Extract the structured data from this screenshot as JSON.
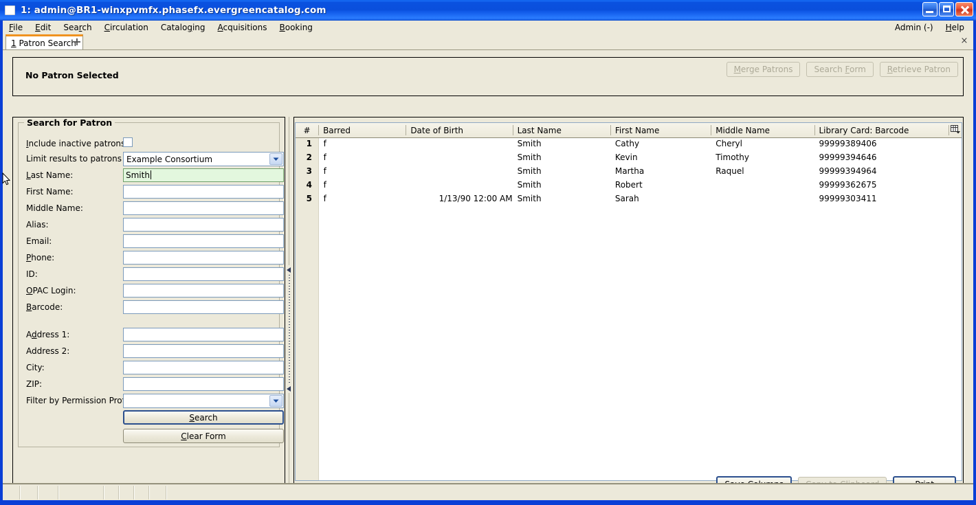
{
  "window": {
    "title": "1: admin@BR1-winxpvmfx.phasefx.evergreencatalog.com",
    "icon": "app-icon",
    "minimize_label": "Minimize",
    "maximize_label": "Maximize",
    "close_label": "Close"
  },
  "menubar": {
    "items": [
      {
        "label": "File",
        "accel": "F"
      },
      {
        "label": "Edit",
        "accel": "E"
      },
      {
        "label": "Search",
        "accel": "r"
      },
      {
        "label": "Circulation",
        "accel": "C"
      },
      {
        "label": "Cataloging",
        "accel": "g"
      },
      {
        "label": "Acquisitions",
        "accel": "A"
      },
      {
        "label": "Booking",
        "accel": "B"
      }
    ],
    "right": [
      {
        "label": "Admin (-)"
      },
      {
        "label": "Help",
        "accel": "H"
      }
    ]
  },
  "tabs": {
    "active": {
      "number": "1",
      "label": "Patron Search"
    },
    "new_tab_label": "+",
    "close_label": "×"
  },
  "patron_summary": {
    "status": "No Patron Selected",
    "buttons": [
      {
        "label": "Merge Patrons",
        "enabled": false
      },
      {
        "label": "Search Form",
        "enabled": false
      },
      {
        "label": "Retrieve Patron",
        "enabled": false
      }
    ]
  },
  "search_form": {
    "legend": "Search for Patron",
    "include_inactive": {
      "label": "Include inactive patrons?",
      "checked": false
    },
    "limit_results": {
      "label": "Limit results to patrons in",
      "value": "Example Consortium"
    },
    "fields": [
      {
        "label": "Last Name:",
        "value": "Smith",
        "placeholder": "",
        "focused": true
      },
      {
        "label": "First Name:",
        "value": "",
        "placeholder": "",
        "focused": false
      },
      {
        "label": "Middle Name:",
        "value": "",
        "placeholder": "",
        "focused": false
      },
      {
        "label": "Alias:",
        "value": "",
        "placeholder": "",
        "focused": false
      },
      {
        "label": "Email:",
        "value": "",
        "placeholder": "",
        "focused": false
      },
      {
        "label": "Phone:",
        "value": "",
        "placeholder": "",
        "focused": false
      },
      {
        "label": "ID:",
        "value": "",
        "placeholder": "",
        "focused": false
      },
      {
        "label": "OPAC Login:",
        "value": "",
        "placeholder": "",
        "focused": false
      },
      {
        "label": "Barcode:",
        "value": "",
        "placeholder": "",
        "focused": false
      }
    ],
    "address_fields": [
      {
        "label": "Address 1:",
        "value": "",
        "placeholder": ""
      },
      {
        "label": "Address 2:",
        "value": "",
        "placeholder": ""
      },
      {
        "label": "City:",
        "value": "",
        "placeholder": ""
      },
      {
        "label": "ZIP:",
        "value": "",
        "placeholder": ""
      }
    ],
    "permission_profile": {
      "label": "Filter by Permission Profile:",
      "value": ""
    },
    "search_button": "Search",
    "clear_button": "Clear Form"
  },
  "results": {
    "columns": [
      {
        "key": "idx",
        "label": "#"
      },
      {
        "key": "barred",
        "label": "Barred"
      },
      {
        "key": "dob",
        "label": "Date of Birth"
      },
      {
        "key": "last",
        "label": "Last Name"
      },
      {
        "key": "first",
        "label": "First Name"
      },
      {
        "key": "middle",
        "label": "Middle Name"
      },
      {
        "key": "barcode",
        "label": "Library Card: Barcode"
      }
    ],
    "column_picker_icon": "column-picker-icon",
    "rows": [
      {
        "idx": "1",
        "barred": "f",
        "dob": "",
        "last": "Smith",
        "first": "Cathy",
        "middle": "Cheryl",
        "barcode": "99999389406"
      },
      {
        "idx": "2",
        "barred": "f",
        "dob": "",
        "last": "Smith",
        "first": "Kevin",
        "middle": "Timothy",
        "barcode": "99999394646"
      },
      {
        "idx": "3",
        "barred": "f",
        "dob": "",
        "last": "Smith",
        "first": "Martha",
        "middle": "Raquel",
        "barcode": "99999394964"
      },
      {
        "idx": "4",
        "barred": "f",
        "dob": "",
        "last": "Smith",
        "first": "Robert",
        "middle": "",
        "barcode": "99999362675"
      },
      {
        "idx": "5",
        "barred": "f",
        "dob": "1/13/90 12:00 AM",
        "last": "Smith",
        "first": "Sarah",
        "middle": "",
        "barcode": "99999303411"
      }
    ],
    "buttons": [
      {
        "label": "Save Columns",
        "enabled": true
      },
      {
        "label": "Copy to Clipboard",
        "enabled": false
      },
      {
        "label": "Print",
        "enabled": true
      }
    ]
  },
  "statusbar": {
    "cells": [
      "",
      "",
      "",
      "",
      "",
      "",
      "",
      ""
    ]
  },
  "colors": {
    "title_blue": "#0a4fdc",
    "window_bg": "#ece9da",
    "focus_field": "#e3f7de",
    "tab_accent": "#f0921e",
    "field_border": "#7b9abb"
  }
}
